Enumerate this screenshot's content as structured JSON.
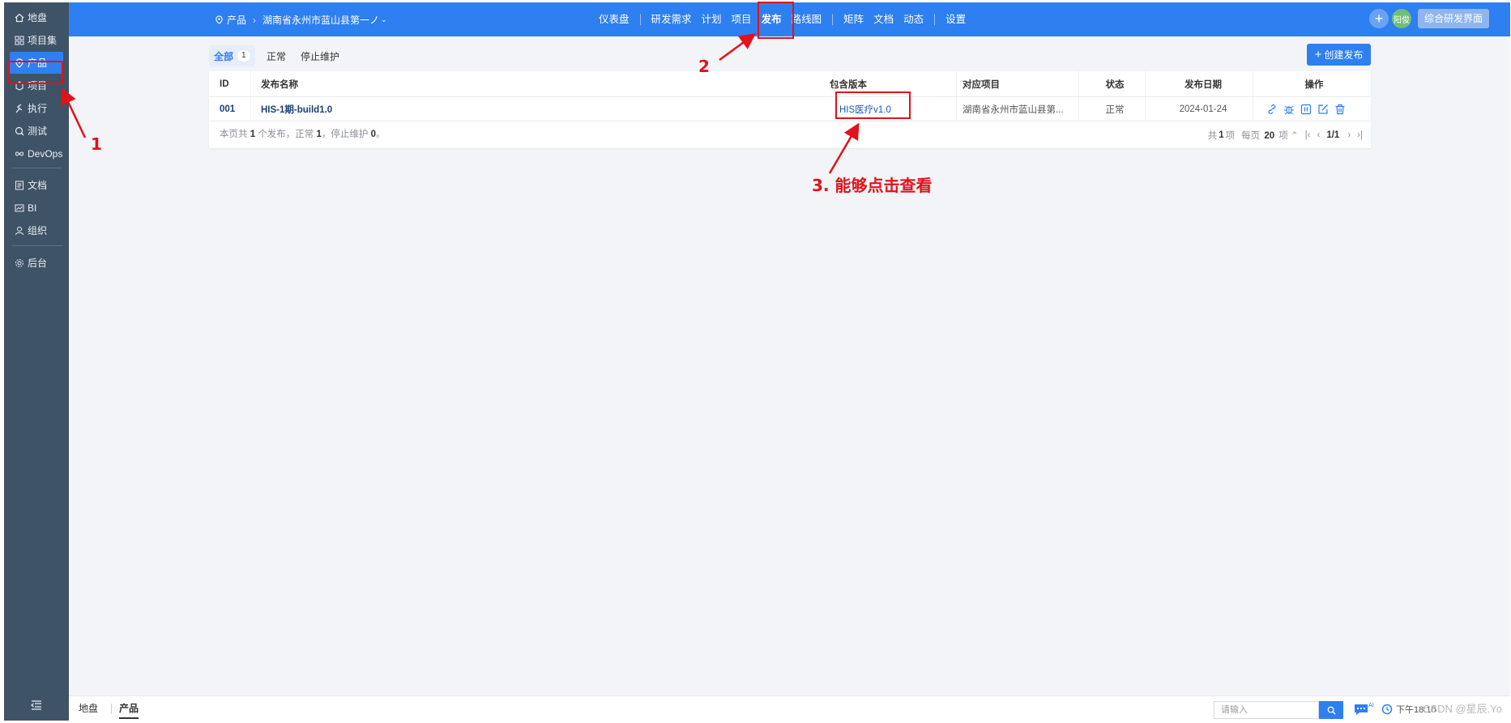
{
  "sidebar": {
    "items": [
      {
        "label": "地盘",
        "icon": "home-icon"
      },
      {
        "label": "项目集",
        "icon": "grid-icon"
      },
      {
        "label": "产品",
        "icon": "product-icon",
        "active": true
      },
      {
        "label": "项目",
        "icon": "project-icon"
      },
      {
        "label": "执行",
        "icon": "run-icon"
      },
      {
        "label": "测试",
        "icon": "test-icon"
      },
      {
        "label": "DevOps",
        "icon": "infinity-icon"
      },
      {
        "label": "文档",
        "icon": "doc-icon"
      },
      {
        "label": "BI",
        "icon": "chart-icon"
      },
      {
        "label": "组织",
        "icon": "org-icon"
      },
      {
        "label": "后台",
        "icon": "gear-icon"
      }
    ]
  },
  "header": {
    "module": "产品",
    "product_name": "湖南省永州市蓝山县第一ノ",
    "nav": [
      "仪表盘",
      "研发需求",
      "计划",
      "项目",
      "发布",
      "路线图",
      "矩阵",
      "文档",
      "动态",
      "设置"
    ],
    "active_nav": "发布",
    "avatar_text": "阳俊",
    "switch_label": "综合研发界面"
  },
  "filters": {
    "tabs": [
      {
        "label": "全部",
        "count": "1",
        "active": true
      },
      {
        "label": "正常"
      },
      {
        "label": "停止维护"
      }
    ],
    "create_label": "创建发布"
  },
  "table": {
    "columns": [
      "ID",
      "发布名称",
      "包含版本",
      "对应项目",
      "状态",
      "发布日期",
      "操作"
    ],
    "rows": [
      {
        "id": "001",
        "name": "HIS-1期-build1.0",
        "build": "HIS医疗v1.0",
        "project": "湖南省永州市蓝山县第...",
        "status": "正常",
        "date": "2024-01-24",
        "actions": [
          "link-icon",
          "bug-icon",
          "pause-icon",
          "edit-icon",
          "delete-icon"
        ]
      }
    ],
    "summary": {
      "prefix": "本页共",
      "total": "1",
      "mid1": "个发布，正常",
      "normal": "1",
      "mid2": "，停止维护",
      "stopped": "0",
      "suffix": "。"
    },
    "pager": {
      "total_prefix": "共",
      "total": "1",
      "total_suffix": "项",
      "per_page_prefix": "每页",
      "per_page": "20",
      "per_page_suffix": "项",
      "page": "1/1"
    }
  },
  "annotations": {
    "label1": "1",
    "label2": "2",
    "label3": "3. 能够点击查看",
    "color": "#e3111a"
  },
  "bottombar": {
    "home": "地盘",
    "current": "产品",
    "search_placeholder": "请输入",
    "time": "下午18:10",
    "watermark": "CSDN @星辰.Yo"
  }
}
